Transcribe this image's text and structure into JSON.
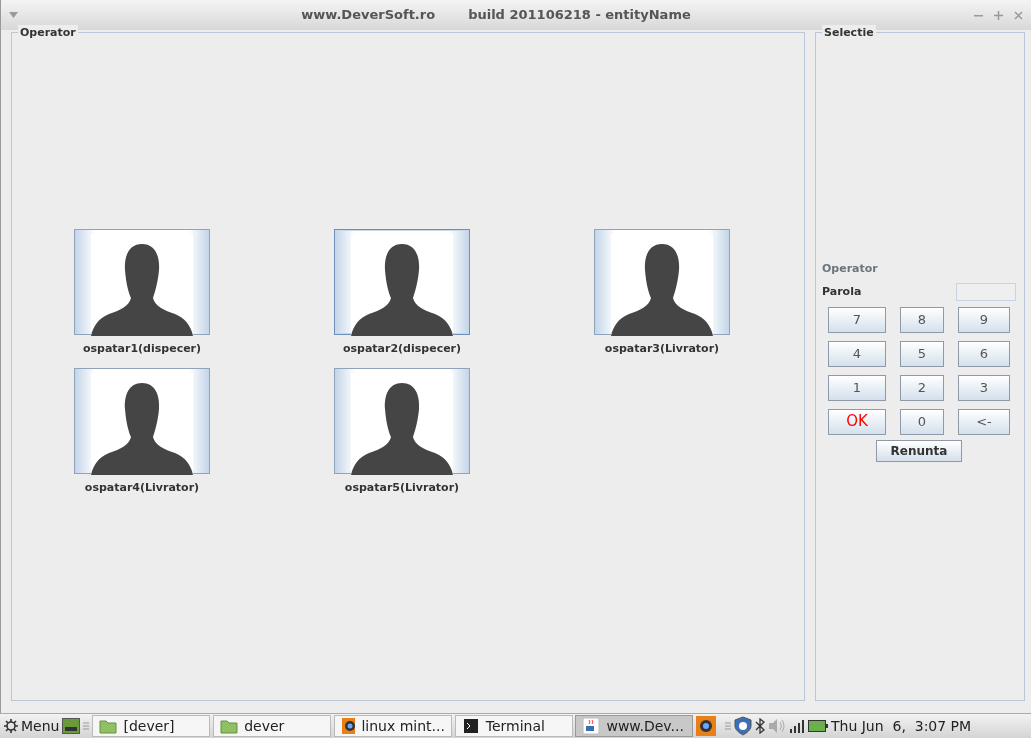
{
  "window": {
    "title": "www.DeverSoft.ro",
    "build": "build 201106218 - entityName"
  },
  "operator_panel": {
    "title": "Operator",
    "operators": [
      {
        "name": "ospatar1(dispecer)",
        "hovered": false
      },
      {
        "name": "ospatar2(dispecer)",
        "hovered": true
      },
      {
        "name": "ospatar3(Livrator)",
        "hovered": false
      },
      {
        "name": "ospatar4(Livrator)",
        "hovered": false
      },
      {
        "name": "ospatar5(Livrator)",
        "hovered": false
      }
    ]
  },
  "selection_panel": {
    "title": "Selectie",
    "operator_label": "Operator",
    "password_label": "Parola",
    "keys": [
      {
        "label": "7",
        "kind": "digit"
      },
      {
        "label": "8",
        "kind": "digit"
      },
      {
        "label": "9",
        "kind": "digit"
      },
      {
        "label": "4",
        "kind": "digit"
      },
      {
        "label": "5",
        "kind": "digit"
      },
      {
        "label": "6",
        "kind": "digit"
      },
      {
        "label": "1",
        "kind": "digit"
      },
      {
        "label": "2",
        "kind": "digit"
      },
      {
        "label": "3",
        "kind": "digit"
      },
      {
        "label": "OK",
        "kind": "ok"
      },
      {
        "label": "0",
        "kind": "digit"
      },
      {
        "label": "<-",
        "kind": "back"
      }
    ],
    "cancel": "Renunta"
  },
  "taskbar": {
    "menu": "Menu",
    "tasks": [
      {
        "label": "[dever]",
        "kind": "folder",
        "selected": false
      },
      {
        "label": "dever",
        "kind": "folder",
        "selected": false
      },
      {
        "label": "linux mint...",
        "kind": "viewer",
        "selected": false
      },
      {
        "label": "Terminal",
        "kind": "terminal",
        "selected": false
      },
      {
        "label": "www.Dev...",
        "kind": "app",
        "selected": true
      }
    ],
    "clock": "Thu Jun  6,  3:07 PM"
  }
}
